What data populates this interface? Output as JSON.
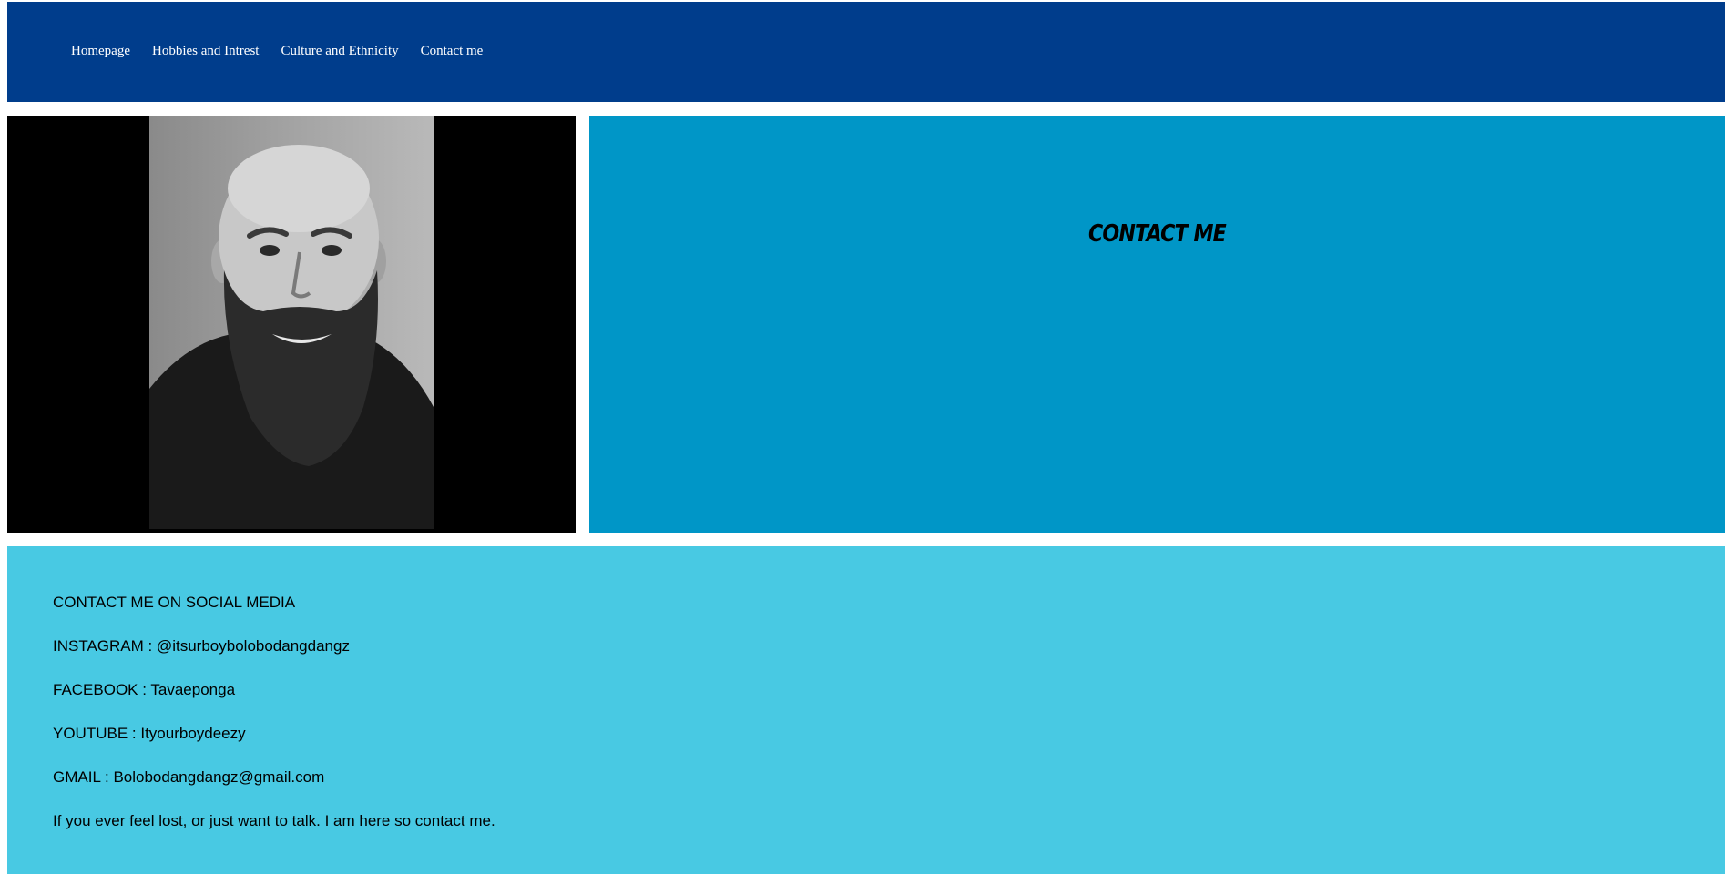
{
  "nav": {
    "links": [
      {
        "label": "Homepage"
      },
      {
        "label": "Hobbies and Intrest"
      },
      {
        "label": "Culture and Ethnicity"
      },
      {
        "label": "Contact me"
      }
    ]
  },
  "hero": {
    "heading": "CONTACT ME",
    "photo_description": "black-and-white portrait photo of a bald man with a full beard"
  },
  "contact": {
    "lines": [
      "CONTACT ME ON SOCIAL MEDIA",
      "INSTAGRAM : @itsurboybolobodangdangz",
      "FACEBOOK : Tavaeponga",
      "YOUTUBE : Ityourboydeezy",
      "GMAIL : Bolobodangdangz@gmail.com",
      "If you ever feel lost, or just want to talk. I am here so contact me."
    ]
  },
  "colors": {
    "navbar": "#003d8c",
    "heading_panel": "#0096c7",
    "contact_panel": "#48c9e3",
    "photo_background": "#000000"
  }
}
